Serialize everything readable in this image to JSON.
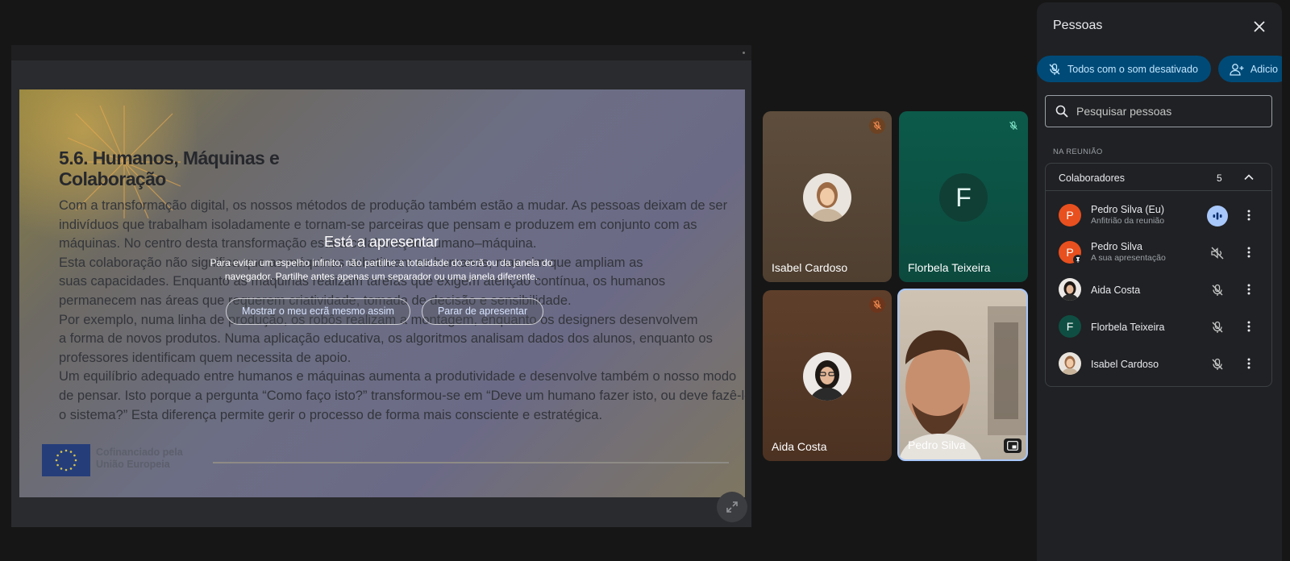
{
  "presentation": {
    "slide": {
      "title_line1": "5.6. Humanos, Máquinas e",
      "title_line2": "Colaboração",
      "body": [
        "Com a transformação digital, os nossos métodos de produção também estão a mudar. As pessoas deixam de ser",
        "indivíduos que trabalham isoladamente e tornam-se parceiras que pensam e produzem em conjunto com as",
        "máquinas. No centro desta transformação está a colaboração humano–máquina.",
        "Esta colaboração não significa que as máquinas substituam os humanos, mas sim que ampliam as",
        "suas capacidades. Enquanto as máquinas realizam tarefas que exigem atenção contínua, os humanos",
        "permanecem nas áreas que requerem criatividade, tomada de decisão e sensibilidade.",
        " Por exemplo, numa linha de produção, os robôs realizam a montagem, enquanto os designers desenvolvem",
        "a forma de novos produtos. Numa aplicação educativa, os algoritmos analisam dados dos alunos, enquanto os",
        "professores identificam quem necessita de apoio.",
        "Um equilíbrio adequado entre humanos e máquinas aumenta a produtividade e desenvolve também o nosso modo",
        "de pensar. Isto porque a pergunta “Como faço isto?” transformou-se em “Deve um humano fazer isto, ou deve fazê-lo",
        "o sistema?” Esta diferença permite gerir o processo de forma mais consciente e estratégica."
      ],
      "footer_line1": "Cofinanciado pela",
      "footer_line2": "União Europeia"
    },
    "overlay": {
      "title": "Está a apresentar",
      "desc_line1": "Para evitar um espelho infinito, não partilhe a totalidade do ecrã ou da janela do",
      "desc_line2": "navegador. Partilhe antes apenas um separador ou uma janela diferente.",
      "show_anyway": "Mostrar o meu ecrã mesmo assim",
      "stop": "Parar de apresentar"
    }
  },
  "tiles": [
    {
      "name": "Isabel Cardoso",
      "muted": true
    },
    {
      "name": "Florbela Teixeira",
      "initial": "F",
      "muted": true
    },
    {
      "name": "Aida Costa",
      "muted": true
    },
    {
      "name": "Pedro Silva",
      "muted": false
    }
  ],
  "panel": {
    "title": "Pessoas",
    "mute_all": "Todos com o som desativado",
    "add": "Adicio",
    "search_placeholder": "Pesquisar pessoas",
    "section": "NA REUNIÃO",
    "group_title": "Colaboradores",
    "group_count": "5",
    "people": [
      {
        "name": "Pedro Silva (Eu)",
        "sub": "Anfitrião da reunião",
        "initial": "P",
        "color": "#e8501f",
        "state": "speaking"
      },
      {
        "name": "Pedro Silva",
        "sub": "A sua apresentação",
        "initial": "P",
        "color": "#e8501f",
        "state": "presenting"
      },
      {
        "name": "Aida Costa",
        "sub": "",
        "initial": "",
        "color": "#5a4034",
        "state": "muted"
      },
      {
        "name": "Florbela Teixeira",
        "sub": "",
        "initial": "F",
        "color": "#0f4f43",
        "state": "muted"
      },
      {
        "name": "Isabel Cardoso",
        "sub": "",
        "initial": "",
        "color": "#8a7360",
        "state": "muted"
      }
    ]
  },
  "colors": {
    "accent": "#a8c7fa",
    "pill_bg": "#004a77",
    "pill_text": "#c2e7ff",
    "muted_icon_orange": "#f28b50",
    "muted_icon_teal": "#7fe3c6"
  }
}
